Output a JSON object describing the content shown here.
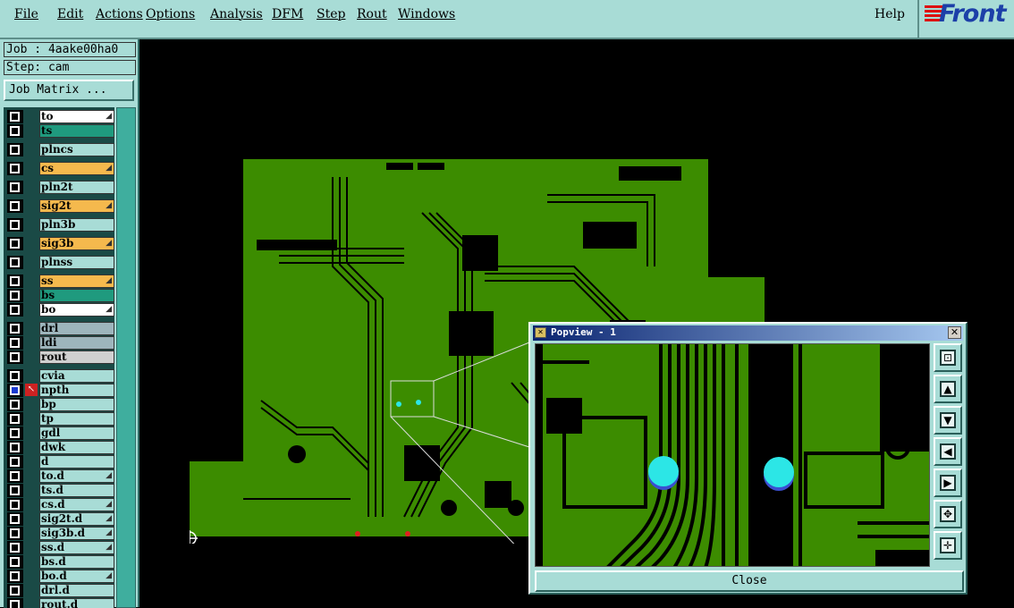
{
  "menubar": {
    "items": [
      "File",
      "Edit",
      "Actions",
      "Options",
      "Analysis",
      "DFM",
      "Step",
      "Rout",
      "Windows"
    ],
    "help": "Help",
    "logo": "Front"
  },
  "job": {
    "job_label": "Job : 4aake00ha0",
    "step_label": "Step: cam",
    "matrix_button": "Job Matrix ..."
  },
  "layers": [
    {
      "name": "to",
      "color": "#ffffff",
      "mark": true
    },
    {
      "name": "ts",
      "color": "#1f9a7e",
      "mark": false
    },
    {
      "name": "plncs",
      "color": "#a8dcd6",
      "mark": false
    },
    {
      "name": "cs",
      "color": "#f5b94d",
      "mark": true
    },
    {
      "name": "pln2t",
      "color": "#a8dcd6",
      "mark": false
    },
    {
      "name": "sig2t",
      "color": "#f5b94d",
      "mark": true
    },
    {
      "name": "pln3b",
      "color": "#a8dcd6",
      "mark": false
    },
    {
      "name": "sig3b",
      "color": "#f5b94d",
      "mark": true
    },
    {
      "name": "plnss",
      "color": "#a8dcd6",
      "mark": false
    },
    {
      "name": "ss",
      "color": "#f5b94d",
      "mark": true
    },
    {
      "name": "bs",
      "color": "#1f9a7e",
      "mark": false
    },
    {
      "name": "bo",
      "color": "#ffffff",
      "mark": true
    },
    {
      "name": "drl",
      "color": "#9db5bc",
      "mark": false
    },
    {
      "name": "ldi",
      "color": "#9db5bc",
      "mark": false
    },
    {
      "name": "rout",
      "color": "#d0d0d0",
      "mark": false
    },
    {
      "name": "cvia",
      "color": "#a8dcd6",
      "mark": false
    },
    {
      "name": "npth",
      "color": "#a8dcd6",
      "mark": false,
      "active": true
    },
    {
      "name": "bp",
      "color": "#a8dcd6",
      "mark": false
    },
    {
      "name": "tp",
      "color": "#a8dcd6",
      "mark": false
    },
    {
      "name": "gdl",
      "color": "#a8dcd6",
      "mark": false
    },
    {
      "name": "dwk",
      "color": "#a8dcd6",
      "mark": false
    },
    {
      "name": "d",
      "color": "#a8dcd6",
      "mark": false
    },
    {
      "name": "to.d",
      "color": "#a8dcd6",
      "mark": true
    },
    {
      "name": "ts.d",
      "color": "#a8dcd6",
      "mark": false
    },
    {
      "name": "cs.d",
      "color": "#a8dcd6",
      "mark": true
    },
    {
      "name": "sig2t.d",
      "color": "#a8dcd6",
      "mark": true
    },
    {
      "name": "sig3b.d",
      "color": "#a8dcd6",
      "mark": true
    },
    {
      "name": "ss.d",
      "color": "#a8dcd6",
      "mark": true
    },
    {
      "name": "bs.d",
      "color": "#a8dcd6",
      "mark": false
    },
    {
      "name": "bo.d",
      "color": "#a8dcd6",
      "mark": true
    },
    {
      "name": "drl.d",
      "color": "#a8dcd6",
      "mark": false
    },
    {
      "name": "rout.d",
      "color": "#a8dcd6",
      "mark": false
    }
  ],
  "popview": {
    "title": "Popview - 1",
    "close_label": "Close",
    "tools": [
      "zoom-fit-icon",
      "pan-up-icon",
      "pan-down-icon",
      "pan-left-icon",
      "pan-right-icon",
      "zoom-in-icon",
      "zoom-out-icon"
    ]
  },
  "colors": {
    "panel": "#a8dcd6",
    "board": "#3c8c00",
    "trace": "#000000",
    "drill": "#2ce6e6"
  }
}
